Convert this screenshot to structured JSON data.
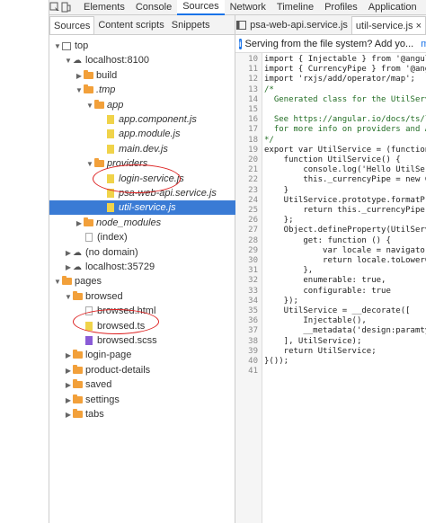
{
  "toolbar": {
    "inspect_icon": "inspect-icon",
    "device_icon": "device-toggle-icon",
    "tabs": [
      "Elements",
      "Console",
      "Sources",
      "Network",
      "Timeline",
      "Profiles",
      "Application",
      "S"
    ],
    "active_tab": "Sources"
  },
  "navigator": {
    "tabs": [
      "Sources",
      "Content scripts",
      "Snippets"
    ],
    "active_tab": "Sources",
    "items": [
      {
        "label": "top",
        "icon": "frame-icon",
        "arrow": "▼"
      },
      {
        "label": "localhost:8100",
        "icon": "cloud-icon",
        "arrow": "▼"
      },
      {
        "label": "build",
        "icon": "folder-icon",
        "arrow": "▶"
      },
      {
        "label": ".tmp",
        "icon": "folder-icon",
        "arrow": "▼"
      },
      {
        "label": "app",
        "icon": "folder-icon",
        "arrow": "▼"
      },
      {
        "label": "app.component.js",
        "icon": "js-file-icon",
        "arrow": ""
      },
      {
        "label": "app.module.js",
        "icon": "js-file-icon",
        "arrow": ""
      },
      {
        "label": "main.dev.js",
        "icon": "js-file-icon",
        "arrow": ""
      },
      {
        "label": "providers",
        "icon": "folder-icon",
        "arrow": "▼"
      },
      {
        "label": "login-service.js",
        "icon": "js-file-icon",
        "arrow": ""
      },
      {
        "label": "psa-web-api.service.js",
        "icon": "js-file-icon",
        "arrow": ""
      },
      {
        "label": "util-service.js",
        "icon": "js-file-icon",
        "arrow": ""
      },
      {
        "label": "node_modules",
        "icon": "folder-icon",
        "arrow": "▶"
      },
      {
        "label": "(index)",
        "icon": "page-file-icon",
        "arrow": ""
      },
      {
        "label": "(no domain)",
        "icon": "cloud-icon",
        "arrow": "▶"
      },
      {
        "label": "localhost:35729",
        "icon": "cloud-icon",
        "arrow": "▶"
      },
      {
        "label": "pages",
        "icon": "folder-icon",
        "arrow": "▼"
      },
      {
        "label": "browsed",
        "icon": "folder-icon",
        "arrow": "▼"
      },
      {
        "label": "browsed.html",
        "icon": "page-file-icon",
        "arrow": ""
      },
      {
        "label": "browsed.ts",
        "icon": "js-file-icon",
        "arrow": ""
      },
      {
        "label": "browsed.scss",
        "icon": "style-file-icon",
        "arrow": ""
      },
      {
        "label": "login-page",
        "icon": "folder-icon",
        "arrow": "▶"
      },
      {
        "label": "product-details",
        "icon": "folder-icon",
        "arrow": "▶"
      },
      {
        "label": "saved",
        "icon": "folder-icon",
        "arrow": "▶"
      },
      {
        "label": "settings",
        "icon": "folder-icon",
        "arrow": "▶"
      },
      {
        "label": "tabs",
        "icon": "folder-icon",
        "arrow": "▶"
      }
    ],
    "selected": "util-service.js"
  },
  "editor": {
    "tabs": [
      "psa-web-api.service.js",
      "util-service.js"
    ],
    "active_tab": "util-service.js",
    "close_glyph": "×",
    "info_text": "Serving from the file system? Add yo...",
    "info_link": "more",
    "lines": [
      {
        "n": "10",
        "text": "import { Injectable } from '@angul"
      },
      {
        "n": "11",
        "text": "import { CurrencyPipe } from '@ang"
      },
      {
        "n": "12",
        "text": "import 'rxjs/add/operator/map';"
      },
      {
        "n": "13",
        "text": "/*"
      },
      {
        "n": "14",
        "text": "  Generated class for the UtilServ"
      },
      {
        "n": "15",
        "text": ""
      },
      {
        "n": "16",
        "text": "  See https://angular.io/docs/ts/l"
      },
      {
        "n": "17",
        "text": "  for more info on providers and A"
      },
      {
        "n": "18",
        "text": "*/"
      },
      {
        "n": "19",
        "text": "export var UtilService = (function"
      },
      {
        "n": "20",
        "text": "    function UtilService() {"
      },
      {
        "n": "21",
        "text": "        console.log('Hello UtilSer"
      },
      {
        "n": "22",
        "text": "        this._currencyPipe = new C"
      },
      {
        "n": "23",
        "text": "    }"
      },
      {
        "n": "24",
        "text": "    UtilService.prototype.formatPr"
      },
      {
        "n": "25",
        "text": "        return this._currencyPipe."
      },
      {
        "n": "26",
        "text": "    };"
      },
      {
        "n": "27",
        "text": "    Object.defineProperty(UtilServ"
      },
      {
        "n": "28",
        "text": "        get: function () {"
      },
      {
        "n": "29",
        "text": "            var locale = navigator"
      },
      {
        "n": "30",
        "text": "            return locale.toLowerC"
      },
      {
        "n": "31",
        "text": "        },"
      },
      {
        "n": "32",
        "text": "        enumerable: true,"
      },
      {
        "n": "33",
        "text": "        configurable: true"
      },
      {
        "n": "34",
        "text": "    });"
      },
      {
        "n": "35",
        "text": "    UtilService = __decorate(["
      },
      {
        "n": "36",
        "text": "        Injectable(),"
      },
      {
        "n": "37",
        "text": "        __metadata('design:paramty"
      },
      {
        "n": "38",
        "text": "    ], UtilService);"
      },
      {
        "n": "39",
        "text": "    return UtilService;"
      },
      {
        "n": "40",
        "text": "}());"
      },
      {
        "n": "41",
        "text": ""
      }
    ]
  },
  "colors": {
    "accent": "#1a73e8",
    "selected_row": "#3a7bd5",
    "folder": "#f2a03a",
    "annotation": "#dd2222",
    "keyword": "#aa0d91",
    "string": "#c41a16",
    "comment": "#236e25"
  }
}
